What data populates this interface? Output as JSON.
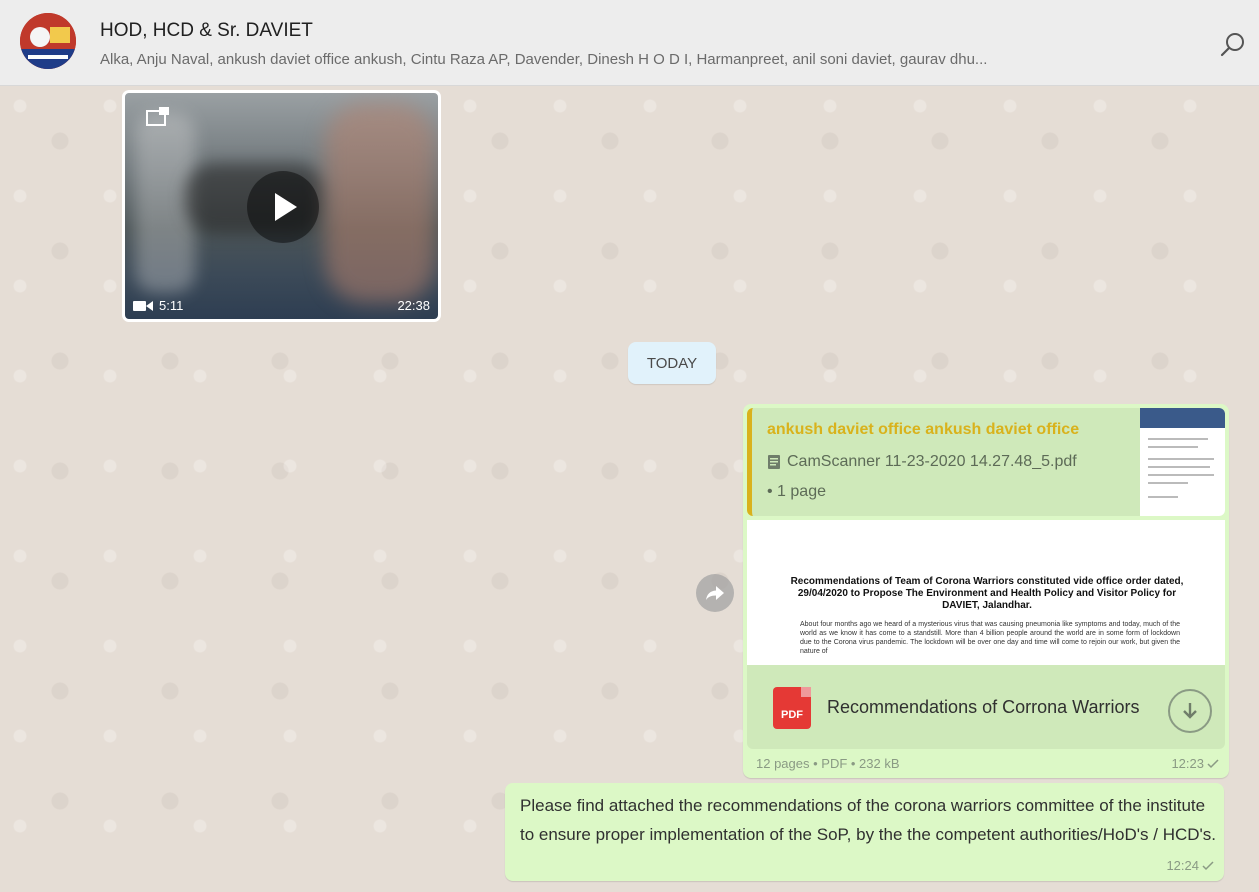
{
  "header": {
    "title": "HOD, HCD & Sr. DAVIET",
    "members": "Alka, Anju Naval, ankush daviet office ankush, Cintu Raza AP, Davender, Dinesh H O D I, Harmanpreet, anil soni daviet, gaurav dhu...",
    "avatar_icon": "group-avatar-icon",
    "search_icon": "search-icon"
  },
  "video_message": {
    "duration": "5:11",
    "time": "22:38"
  },
  "day_separator": "TODAY",
  "document_message": {
    "quoted_author": "ankush daviet office ankush daviet office",
    "quoted_file": "CamScanner 11-23-2020 14.27.48_5.pdf",
    "quoted_pages": "• 1 page",
    "preview_title": "Recommendations of Team of Corona Warriors constituted vide office order dated, 29/04/2020 to Propose The Environment and Health Policy and Visitor Policy for DAVIET, Jalandhar.",
    "preview_body": "About four months ago we heard of a mysterious virus that was causing pneumonia like symptoms and today, much of the world as we know it has come to a standstill. More than 4 billion people around the world are in some form of lockdown due to the Corona virus pandemic. The lockdown will be over one day and time will come to rejoin our work, but given the nature of",
    "pdf_label": "PDF",
    "file_name": "Recommendations of Corrona Warriors",
    "meta": "12 pages • PDF • 232 kB",
    "time": "12:23"
  },
  "text_message": {
    "body": "Please find attached the recommendations of the corona warriors committee of the institute to ensure proper implementation of the SoP, by the the competent authorities/HoD's / HCD's.",
    "time": "12:24"
  },
  "colors": {
    "outgoing_bubble": "#dcf8c6",
    "quote_accent": "#d9b21c",
    "header_bg": "#ededed",
    "pdf_red": "#e53935"
  }
}
